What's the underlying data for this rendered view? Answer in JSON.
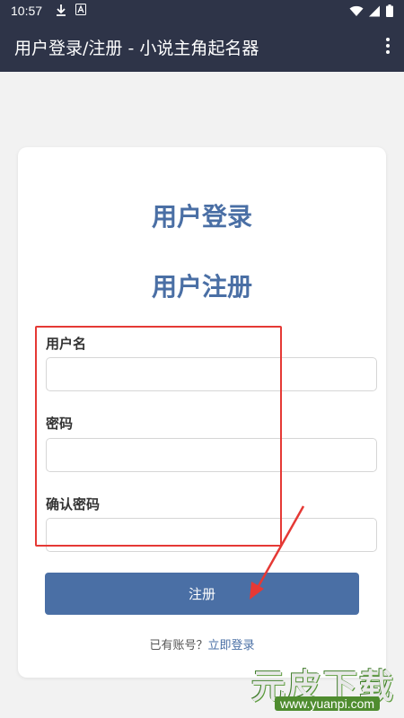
{
  "status_bar": {
    "time": "10:57",
    "icons": [
      "download-icon",
      "notification-a-icon",
      "wifi-icon",
      "signal-icon",
      "battery-icon"
    ]
  },
  "app_bar": {
    "title": "用户登录/注册 - 小说主角起名器",
    "menu_icon": "more-vert-icon"
  },
  "card": {
    "login_heading": "用户登录",
    "register_heading": "用户注册",
    "fields": [
      {
        "label": "用户名",
        "value": "",
        "placeholder": ""
      },
      {
        "label": "密码",
        "value": "",
        "placeholder": ""
      },
      {
        "label": "确认密码",
        "value": "",
        "placeholder": ""
      }
    ],
    "register_button": "注册",
    "login_prompt": "已有账号？",
    "login_link": "立即登录"
  },
  "watermark": {
    "text": "元皮下载",
    "url": "www.yuanpi.com"
  },
  "colors": {
    "app_bar": "#2e3448",
    "accent": "#4a6fa5",
    "annotation": "#e53935",
    "background": "#f2f2f2"
  }
}
